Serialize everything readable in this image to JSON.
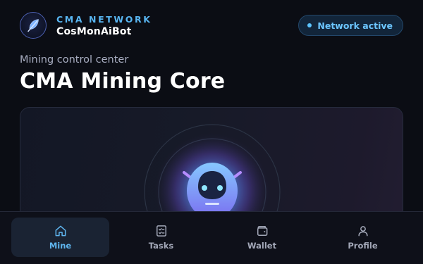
{
  "header": {
    "brand_network": "CMA NETWORK",
    "brand_bot": "CosMonAiBot",
    "status_label": "Network active"
  },
  "page": {
    "subtitle": "Mining control center",
    "title": "CMA Mining Core"
  },
  "bottom_nav": {
    "items": [
      {
        "label": "Mine",
        "icon": "home-icon",
        "active": true
      },
      {
        "label": "Tasks",
        "icon": "checklist-icon",
        "active": false
      },
      {
        "label": "Wallet",
        "icon": "wallet-icon",
        "active": false
      },
      {
        "label": "Profile",
        "icon": "user-icon",
        "active": false
      }
    ]
  },
  "colors": {
    "accent": "#59b6f2",
    "background": "#0b0d14",
    "status_dot": "#5cc4ff"
  }
}
